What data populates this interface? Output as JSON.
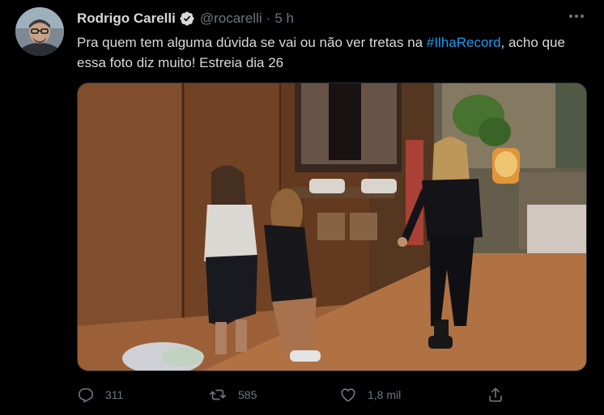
{
  "tweet": {
    "author": {
      "name": "Rodrigo Carelli",
      "handle": "@rocarelli",
      "separator": "·",
      "time": "5 h",
      "verified": true
    },
    "text_before": "Pra quem tem alguma dúvida se vai ou não ver tretas na ",
    "hashtag": "#IlhaRecord",
    "text_after": ", acho que essa foto diz muito! Estreia dia 26",
    "media": {
      "type": "photo",
      "icon": "photo-image"
    },
    "actions": {
      "reply": {
        "icon": "reply-icon",
        "count": "311"
      },
      "retweet": {
        "icon": "retweet-icon",
        "count": "585"
      },
      "like": {
        "icon": "heart-icon",
        "count": "1,8 mil"
      },
      "share": {
        "icon": "share-icon"
      }
    }
  },
  "colors": {
    "background": "#000000",
    "text": "#d9d9d9",
    "secondary": "#6e767d",
    "link": "#1d9bf0",
    "verified_badge": "#d9d9d9"
  }
}
